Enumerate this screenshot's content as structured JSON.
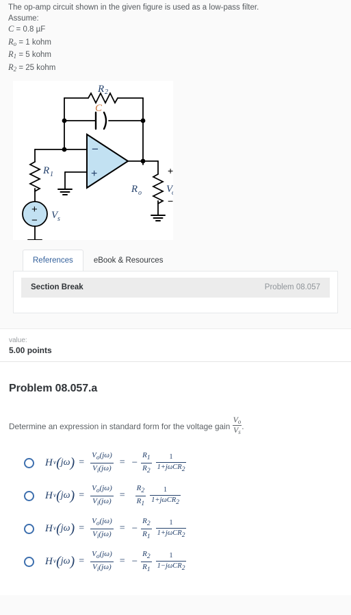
{
  "statement": {
    "lines": [
      "The op-amp circuit shown in the given figure is used as a low-pass filter.",
      "Assume:"
    ],
    "assumptions": [
      {
        "sym": "C",
        "sub": "",
        "value": "= 0.8 µF"
      },
      {
        "sym": "R",
        "sub": "o",
        "value": "= 1 kohm"
      },
      {
        "sym": "R",
        "sub": "1",
        "value": "= 5 kohm"
      },
      {
        "sym": "R",
        "sub": "2",
        "value": "= 25 kohm"
      }
    ]
  },
  "figure": {
    "name": "op-amp-low-pass-filter-circuit",
    "labels": {
      "r2": "R",
      "r2_sub": "2",
      "c": "C",
      "r1": "R",
      "r1_sub": "1",
      "vs": "V",
      "vs_sub": "s",
      "ro": "R",
      "ro_sub": "o",
      "vo": "V",
      "vo_sub": "o",
      "opamp_minus": "−",
      "opamp_plus": "+",
      "source_plus": "+",
      "source_minus": "−",
      "out_plus": "+",
      "out_minus": "−"
    },
    "colors": {
      "opamp_fill": "#c2e1f2",
      "source_fill": "#c2e1f2",
      "wire": "#000000",
      "label_blue": "#23406b",
      "label_orange": "#c87137"
    }
  },
  "tabs": [
    {
      "label": "References",
      "active": true
    },
    {
      "label": "eBook & Resources",
      "active": false
    }
  ],
  "section": {
    "title": "Section Break",
    "reference": "Problem 08.057"
  },
  "value": {
    "label": "value:",
    "points": "5.00 points"
  },
  "problem": {
    "heading": "Problem 08.057.a",
    "question_prefix": "Determine an expression in standard form for the voltage gain",
    "gain_num": "V",
    "gain_num_sub": "o",
    "gain_den": "V",
    "gain_den_sub": "s",
    "question_suffix": "."
  },
  "options": [
    {
      "id": "option-a",
      "lhs": "H",
      "lhs_sub": "v",
      "arg": "jω",
      "ratio_num": "V",
      "ratio_num_sub": "o",
      "ratio_num_arg": "(jω)",
      "ratio_den": "V",
      "ratio_den_sub": "i",
      "ratio_den_arg": "(jω)",
      "sign": "−",
      "res_num": "R",
      "res_num_sub": "1",
      "res_den": "R",
      "res_den_sub": "2",
      "pole_num": "1",
      "pole_den": "1+jωCR",
      "pole_den_sub": "2",
      "selected": false
    },
    {
      "id": "option-b",
      "lhs": "H",
      "lhs_sub": "v",
      "arg": "jω",
      "ratio_num": "V",
      "ratio_num_sub": "o",
      "ratio_num_arg": "(jω)",
      "ratio_den": "V",
      "ratio_den_sub": "i",
      "ratio_den_arg": "(jω)",
      "sign": "",
      "res_num": "R",
      "res_num_sub": "2",
      "res_den": "R",
      "res_den_sub": "1",
      "pole_num": "1",
      "pole_den": "1+jωCR",
      "pole_den_sub": "2",
      "selected": false
    },
    {
      "id": "option-c",
      "lhs": "H",
      "lhs_sub": "v",
      "arg": "jω",
      "ratio_num": "V",
      "ratio_num_sub": "o",
      "ratio_num_arg": "(jω)",
      "ratio_den": "V",
      "ratio_den_sub": "i",
      "ratio_den_arg": "(jω)",
      "sign": "−",
      "res_num": "R",
      "res_num_sub": "2",
      "res_den": "R",
      "res_den_sub": "1",
      "pole_num": "1",
      "pole_den": "1+jωCR",
      "pole_den_sub": "2",
      "selected": false
    },
    {
      "id": "option-d",
      "lhs": "H",
      "lhs_sub": "v",
      "arg": "jω",
      "ratio_num": "V",
      "ratio_num_sub": "o",
      "ratio_num_arg": "(jω)",
      "ratio_den": "V",
      "ratio_den_sub": "i",
      "ratio_den_arg": "(jω)",
      "sign": "−",
      "res_num": "R",
      "res_num_sub": "2",
      "res_den": "R",
      "res_den_sub": "1",
      "pole_num": "1",
      "pole_den": "1−jωCR",
      "pole_den_sub": "2",
      "selected": false
    }
  ]
}
